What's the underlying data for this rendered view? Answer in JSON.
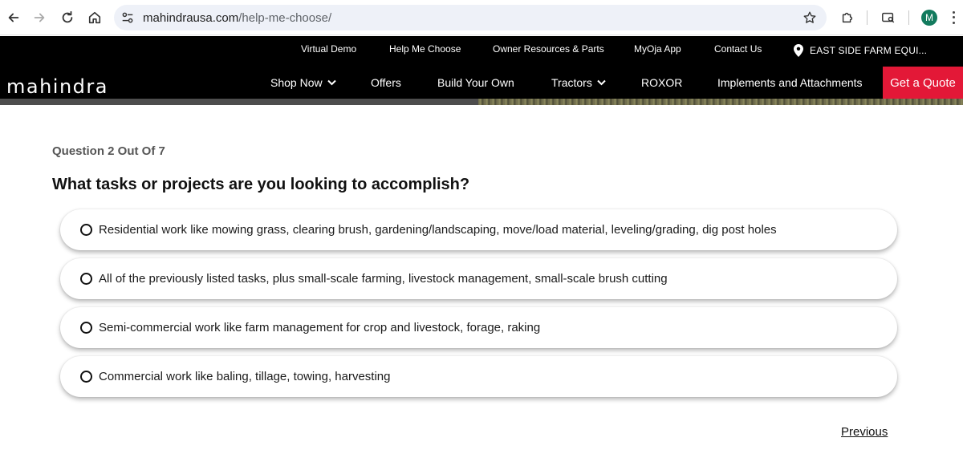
{
  "browser": {
    "url_host": "mahindrausa.com",
    "url_path": "/help-me-choose/",
    "profile_initial": "M"
  },
  "header": {
    "utility_links": [
      "Virtual Demo",
      "Help Me Choose",
      "Owner Resources & Parts",
      "MyOja App",
      "Contact Us"
    ],
    "dealer": "EAST SIDE FARM EQUI...",
    "logo": "mahindra",
    "main_nav": [
      {
        "label": "Shop Now",
        "dropdown": true
      },
      {
        "label": "Offers",
        "dropdown": false
      },
      {
        "label": "Build Your Own",
        "dropdown": false
      },
      {
        "label": "Tractors",
        "dropdown": true
      },
      {
        "label": "ROXOR",
        "dropdown": false
      },
      {
        "label": "Implements and Attachments",
        "dropdown": false
      }
    ],
    "cta": "Get a Quote",
    "cta_color": "#e31837"
  },
  "question": {
    "counter": "Question 2 Out Of 7",
    "title": "What tasks or projects are you looking to accomplish?",
    "options": [
      "Residential work like mowing grass, clearing brush, gardening/landscaping, move/load material, leveling/grading, dig post holes",
      "All of the previously listed tasks, plus small-scale farming, livestock management, small-scale brush cutting",
      "Semi-commercial work like farm management for crop and livestock, forage, raking",
      "Commercial work like baling, tillage, towing, harvesting"
    ],
    "previous_label": "Previous"
  }
}
